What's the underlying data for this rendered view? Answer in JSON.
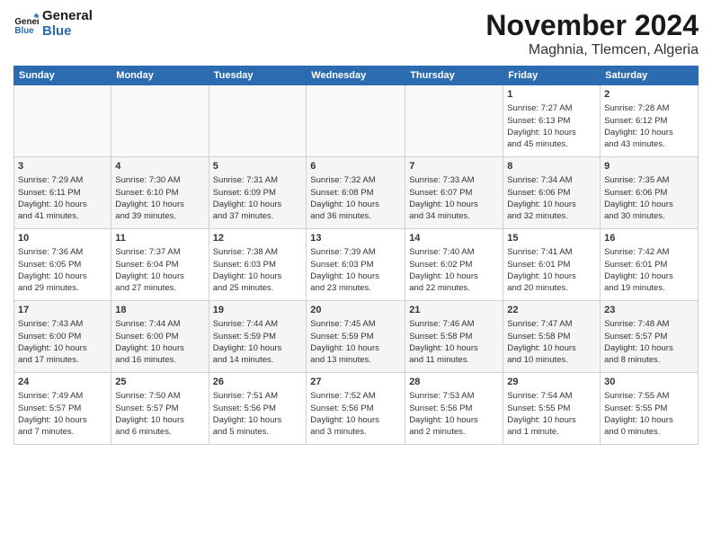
{
  "logo": {
    "line1": "General",
    "line2": "Blue"
  },
  "title": "November 2024",
  "location": "Maghnia, Tlemcen, Algeria",
  "headers": [
    "Sunday",
    "Monday",
    "Tuesday",
    "Wednesday",
    "Thursday",
    "Friday",
    "Saturday"
  ],
  "weeks": [
    [
      {
        "day": "",
        "data": ""
      },
      {
        "day": "",
        "data": ""
      },
      {
        "day": "",
        "data": ""
      },
      {
        "day": "",
        "data": ""
      },
      {
        "day": "",
        "data": ""
      },
      {
        "day": "1",
        "data": "Sunrise: 7:27 AM\nSunset: 6:13 PM\nDaylight: 10 hours\nand 45 minutes."
      },
      {
        "day": "2",
        "data": "Sunrise: 7:28 AM\nSunset: 6:12 PM\nDaylight: 10 hours\nand 43 minutes."
      }
    ],
    [
      {
        "day": "3",
        "data": "Sunrise: 7:29 AM\nSunset: 6:11 PM\nDaylight: 10 hours\nand 41 minutes."
      },
      {
        "day": "4",
        "data": "Sunrise: 7:30 AM\nSunset: 6:10 PM\nDaylight: 10 hours\nand 39 minutes."
      },
      {
        "day": "5",
        "data": "Sunrise: 7:31 AM\nSunset: 6:09 PM\nDaylight: 10 hours\nand 37 minutes."
      },
      {
        "day": "6",
        "data": "Sunrise: 7:32 AM\nSunset: 6:08 PM\nDaylight: 10 hours\nand 36 minutes."
      },
      {
        "day": "7",
        "data": "Sunrise: 7:33 AM\nSunset: 6:07 PM\nDaylight: 10 hours\nand 34 minutes."
      },
      {
        "day": "8",
        "data": "Sunrise: 7:34 AM\nSunset: 6:06 PM\nDaylight: 10 hours\nand 32 minutes."
      },
      {
        "day": "9",
        "data": "Sunrise: 7:35 AM\nSunset: 6:06 PM\nDaylight: 10 hours\nand 30 minutes."
      }
    ],
    [
      {
        "day": "10",
        "data": "Sunrise: 7:36 AM\nSunset: 6:05 PM\nDaylight: 10 hours\nand 29 minutes."
      },
      {
        "day": "11",
        "data": "Sunrise: 7:37 AM\nSunset: 6:04 PM\nDaylight: 10 hours\nand 27 minutes."
      },
      {
        "day": "12",
        "data": "Sunrise: 7:38 AM\nSunset: 6:03 PM\nDaylight: 10 hours\nand 25 minutes."
      },
      {
        "day": "13",
        "data": "Sunrise: 7:39 AM\nSunset: 6:03 PM\nDaylight: 10 hours\nand 23 minutes."
      },
      {
        "day": "14",
        "data": "Sunrise: 7:40 AM\nSunset: 6:02 PM\nDaylight: 10 hours\nand 22 minutes."
      },
      {
        "day": "15",
        "data": "Sunrise: 7:41 AM\nSunset: 6:01 PM\nDaylight: 10 hours\nand 20 minutes."
      },
      {
        "day": "16",
        "data": "Sunrise: 7:42 AM\nSunset: 6:01 PM\nDaylight: 10 hours\nand 19 minutes."
      }
    ],
    [
      {
        "day": "17",
        "data": "Sunrise: 7:43 AM\nSunset: 6:00 PM\nDaylight: 10 hours\nand 17 minutes."
      },
      {
        "day": "18",
        "data": "Sunrise: 7:44 AM\nSunset: 6:00 PM\nDaylight: 10 hours\nand 16 minutes."
      },
      {
        "day": "19",
        "data": "Sunrise: 7:44 AM\nSunset: 5:59 PM\nDaylight: 10 hours\nand 14 minutes."
      },
      {
        "day": "20",
        "data": "Sunrise: 7:45 AM\nSunset: 5:59 PM\nDaylight: 10 hours\nand 13 minutes."
      },
      {
        "day": "21",
        "data": "Sunrise: 7:46 AM\nSunset: 5:58 PM\nDaylight: 10 hours\nand 11 minutes."
      },
      {
        "day": "22",
        "data": "Sunrise: 7:47 AM\nSunset: 5:58 PM\nDaylight: 10 hours\nand 10 minutes."
      },
      {
        "day": "23",
        "data": "Sunrise: 7:48 AM\nSunset: 5:57 PM\nDaylight: 10 hours\nand 8 minutes."
      }
    ],
    [
      {
        "day": "24",
        "data": "Sunrise: 7:49 AM\nSunset: 5:57 PM\nDaylight: 10 hours\nand 7 minutes."
      },
      {
        "day": "25",
        "data": "Sunrise: 7:50 AM\nSunset: 5:57 PM\nDaylight: 10 hours\nand 6 minutes."
      },
      {
        "day": "26",
        "data": "Sunrise: 7:51 AM\nSunset: 5:56 PM\nDaylight: 10 hours\nand 5 minutes."
      },
      {
        "day": "27",
        "data": "Sunrise: 7:52 AM\nSunset: 5:56 PM\nDaylight: 10 hours\nand 3 minutes."
      },
      {
        "day": "28",
        "data": "Sunrise: 7:53 AM\nSunset: 5:56 PM\nDaylight: 10 hours\nand 2 minutes."
      },
      {
        "day": "29",
        "data": "Sunrise: 7:54 AM\nSunset: 5:55 PM\nDaylight: 10 hours\nand 1 minute."
      },
      {
        "day": "30",
        "data": "Sunrise: 7:55 AM\nSunset: 5:55 PM\nDaylight: 10 hours\nand 0 minutes."
      }
    ]
  ]
}
